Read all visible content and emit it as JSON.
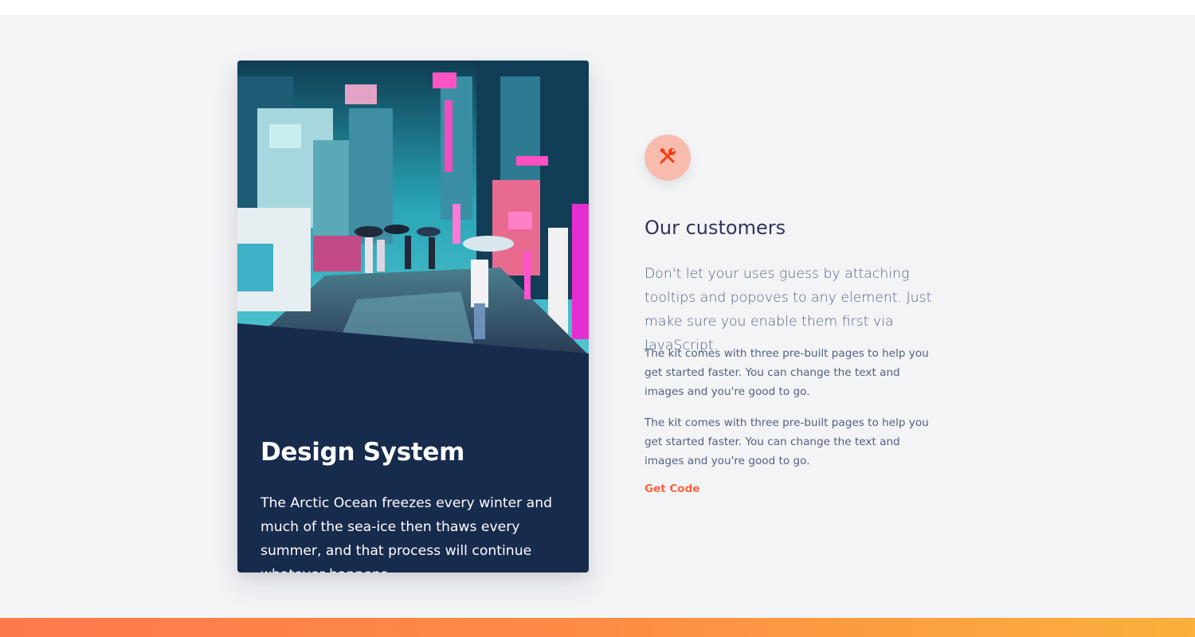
{
  "card": {
    "title": "Design System",
    "text": "The Arctic Ocean freezes every winter and much of the sea-ice then thaws every summer, and that process will continue whatever happens.",
    "image_icon": "neon-street-photo"
  },
  "feature": {
    "icon": "tools-icon",
    "heading": "Our customers",
    "lead": "Don't let your uses guess by attaching tooltips and popoves to any element. Just make sure you enable them first via JavaScript.",
    "paragraphs": [
      "The kit comes with three pre-built pages to help you get started faster. You can change the text and images and you're good to go.",
      "The kit comes with three pre-built pages to help you get started faster. You can change the text and images and you're good to go."
    ],
    "link_label": "Get Code"
  },
  "colors": {
    "card_bg": "#172b4d",
    "section_bg": "#f3f4f6",
    "accent": "#fb6340",
    "icon_circle": "#f8bcae",
    "heading": "#32325d",
    "body_text": "#525f7f",
    "gradient_start": "#fd7a4c",
    "gradient_end": "#fbb13c"
  }
}
